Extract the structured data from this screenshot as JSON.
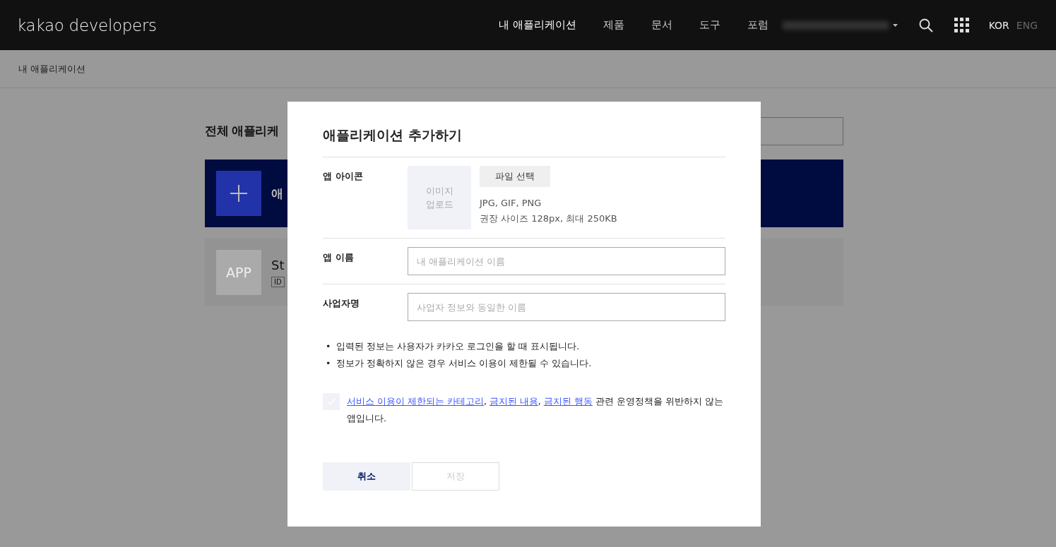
{
  "header": {
    "logo": "kakao developers",
    "nav": [
      {
        "label": "내 애플리케이션",
        "selected": true
      },
      {
        "label": "제품",
        "selected": false
      },
      {
        "label": "문서",
        "selected": false
      },
      {
        "label": "도구",
        "selected": false
      },
      {
        "label": "포럼",
        "selected": false
      }
    ],
    "languages": [
      {
        "label": "KOR",
        "selected": true
      },
      {
        "label": "ENG",
        "selected": false
      }
    ]
  },
  "breadcrumb": "내 애플리케이션",
  "background": {
    "title": "전체 애플리케",
    "add_card": {
      "label": "애"
    },
    "app_card": {
      "icon": "APP",
      "name": "St",
      "tag": "ID"
    }
  },
  "dialog": {
    "title": "애플리케이션 추가하기",
    "icon_row": {
      "label": "앱 아이콘",
      "upload": "이미지\n업로드",
      "button": "파일 선택",
      "hints": [
        "JPG, GIF, PNG",
        "권장 사이즈 128px, 최대 250KB"
      ]
    },
    "fields": [
      {
        "label": "앱 이름",
        "placeholder": "내 애플리케이션 이름"
      },
      {
        "label": "사업자명",
        "placeholder": "사업자 정보와 동일한 이름"
      }
    ],
    "notes": [
      {
        "marker": "•",
        "text": "입력된 정보는 사용자가 카카오 로그인을 할 때 표시됩니다."
      },
      {
        "marker": "•",
        "text": "정보가 정확하지 않은 경우 서비스 이용이 제한될 수 있습니다."
      }
    ],
    "agreement": {
      "checked": false,
      "links": [
        {
          "label": "서비스 이용이 제한되는 카테고리",
          "after": ","
        },
        {
          "label": "금지된 내용",
          "after": ","
        },
        {
          "label": "금지된 행동"
        }
      ],
      "text": "관련 운영정책을 위반하지 않는 앱입니다."
    },
    "buttons": [
      {
        "label": "취소",
        "disabled": false,
        "kind": "cancel"
      },
      {
        "label": "저장",
        "disabled": true,
        "kind": "save"
      }
    ]
  }
}
